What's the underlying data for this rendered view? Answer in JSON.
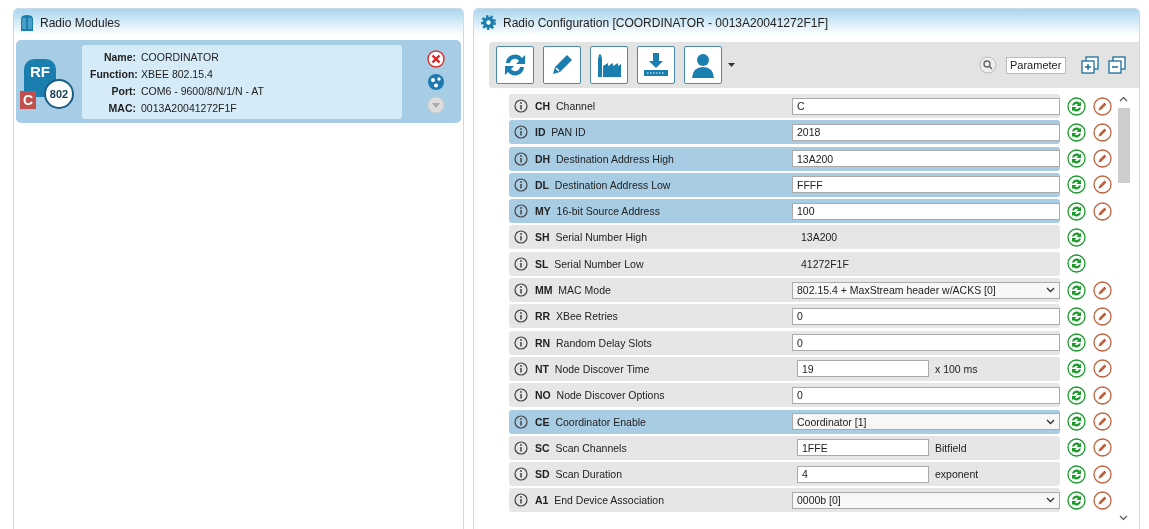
{
  "modules_panel": {
    "title": "Radio Modules"
  },
  "module": {
    "badge_letter": "C",
    "icon_label": "RF",
    "protocol": "802",
    "fields": [
      {
        "label": "Name:",
        "value": "COORDINATOR"
      },
      {
        "label": "Function:",
        "value": "XBEE 802.15.4"
      },
      {
        "label": "Port:",
        "value": "COM6 - 9600/8/N/1/N - AT"
      },
      {
        "label": "MAC:",
        "value": "0013A20041272F1F"
      }
    ]
  },
  "config_panel": {
    "title": "Radio Configuration [COORDINATOR - 0013A20041272F1F]",
    "search": {
      "placeholder": "Parameter"
    }
  },
  "parameters": [
    {
      "code": "CH",
      "name": "Channel",
      "kind": "input",
      "value": "C",
      "changed": false
    },
    {
      "code": "ID",
      "name": "PAN ID",
      "kind": "input",
      "value": "2018",
      "changed": true
    },
    {
      "code": "DH",
      "name": "Destination Address High",
      "kind": "input",
      "value": "13A200",
      "changed": true
    },
    {
      "code": "DL",
      "name": "Destination Address Low",
      "kind": "input",
      "value": "FFFF",
      "changed": true
    },
    {
      "code": "MY",
      "name": "16-bit Source Address",
      "kind": "input",
      "value": "100",
      "changed": true
    },
    {
      "code": "SH",
      "name": "Serial Number High",
      "kind": "readonly",
      "value": "13A200",
      "changed": false
    },
    {
      "code": "SL",
      "name": "Serial Number Low",
      "kind": "readonly",
      "value": "41272F1F",
      "changed": false
    },
    {
      "code": "MM",
      "name": "MAC Mode",
      "kind": "select",
      "value": "802.15.4 + MaxStream header w/ACKS [0]",
      "changed": false
    },
    {
      "code": "RR",
      "name": "XBee Retries",
      "kind": "input",
      "value": "0",
      "changed": false
    },
    {
      "code": "RN",
      "name": "Random Delay Slots",
      "kind": "input",
      "value": "0",
      "changed": false
    },
    {
      "code": "NT",
      "name": "Node Discover Time",
      "kind": "input",
      "value": "19",
      "unit": "x 100 ms",
      "changed": false
    },
    {
      "code": "NO",
      "name": "Node Discover Options",
      "kind": "input",
      "value": "0",
      "changed": false
    },
    {
      "code": "CE",
      "name": "Coordinator Enable",
      "kind": "select",
      "value": "Coordinator [1]",
      "changed": true
    },
    {
      "code": "SC",
      "name": "Scan Channels",
      "kind": "input",
      "value": "1FFE",
      "unit": "Bitfield",
      "changed": false
    },
    {
      "code": "SD",
      "name": "Scan Duration",
      "kind": "input",
      "value": "4",
      "unit": "exponent",
      "changed": false
    },
    {
      "code": "A1",
      "name": "End Device Association",
      "kind": "select",
      "value": "0000b [0]",
      "changed": false
    }
  ]
}
